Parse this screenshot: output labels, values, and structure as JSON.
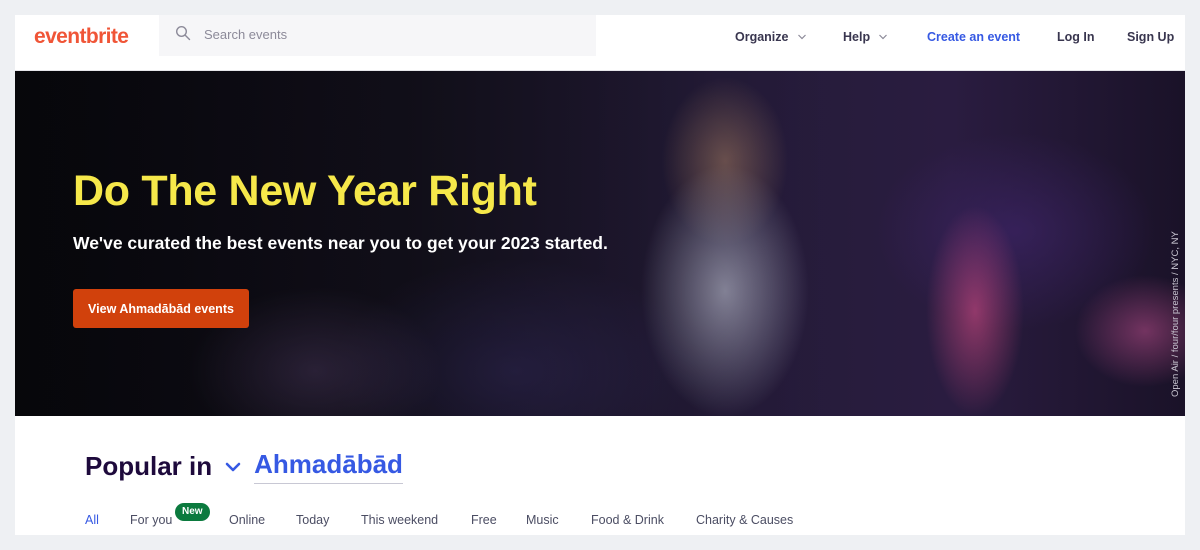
{
  "header": {
    "logo": "eventbrite",
    "search": {
      "placeholder": "Search events",
      "value": ""
    },
    "nav": {
      "organize": "Organize",
      "help": "Help",
      "create": "Create an event",
      "login": "Log In",
      "signup": "Sign Up"
    }
  },
  "hero": {
    "title": "Do The New Year Right",
    "subtitle": "We've curated the best events near you to get your 2023 started.",
    "button": "View Ahmadābād events",
    "credit": "Open Air / four/four presents / NYC, NY"
  },
  "popular": {
    "label": "Popular in",
    "location": "Ahmadābād"
  },
  "tabs": {
    "all": "All",
    "for_you": "For you",
    "new_badge": "New",
    "online": "Online",
    "today": "Today",
    "this_weekend": "This weekend",
    "free": "Free",
    "music": "Music",
    "food_drink": "Food & Drink",
    "charity": "Charity & Causes"
  },
  "colors": {
    "brand": "#f05537",
    "accent_blue": "#3659e3",
    "hero_title": "#f6e84a",
    "cta": "#d1410c",
    "badge": "#0b7a3e"
  },
  "icons": {
    "search": "search-icon",
    "chevron": "chevron-down-icon"
  }
}
